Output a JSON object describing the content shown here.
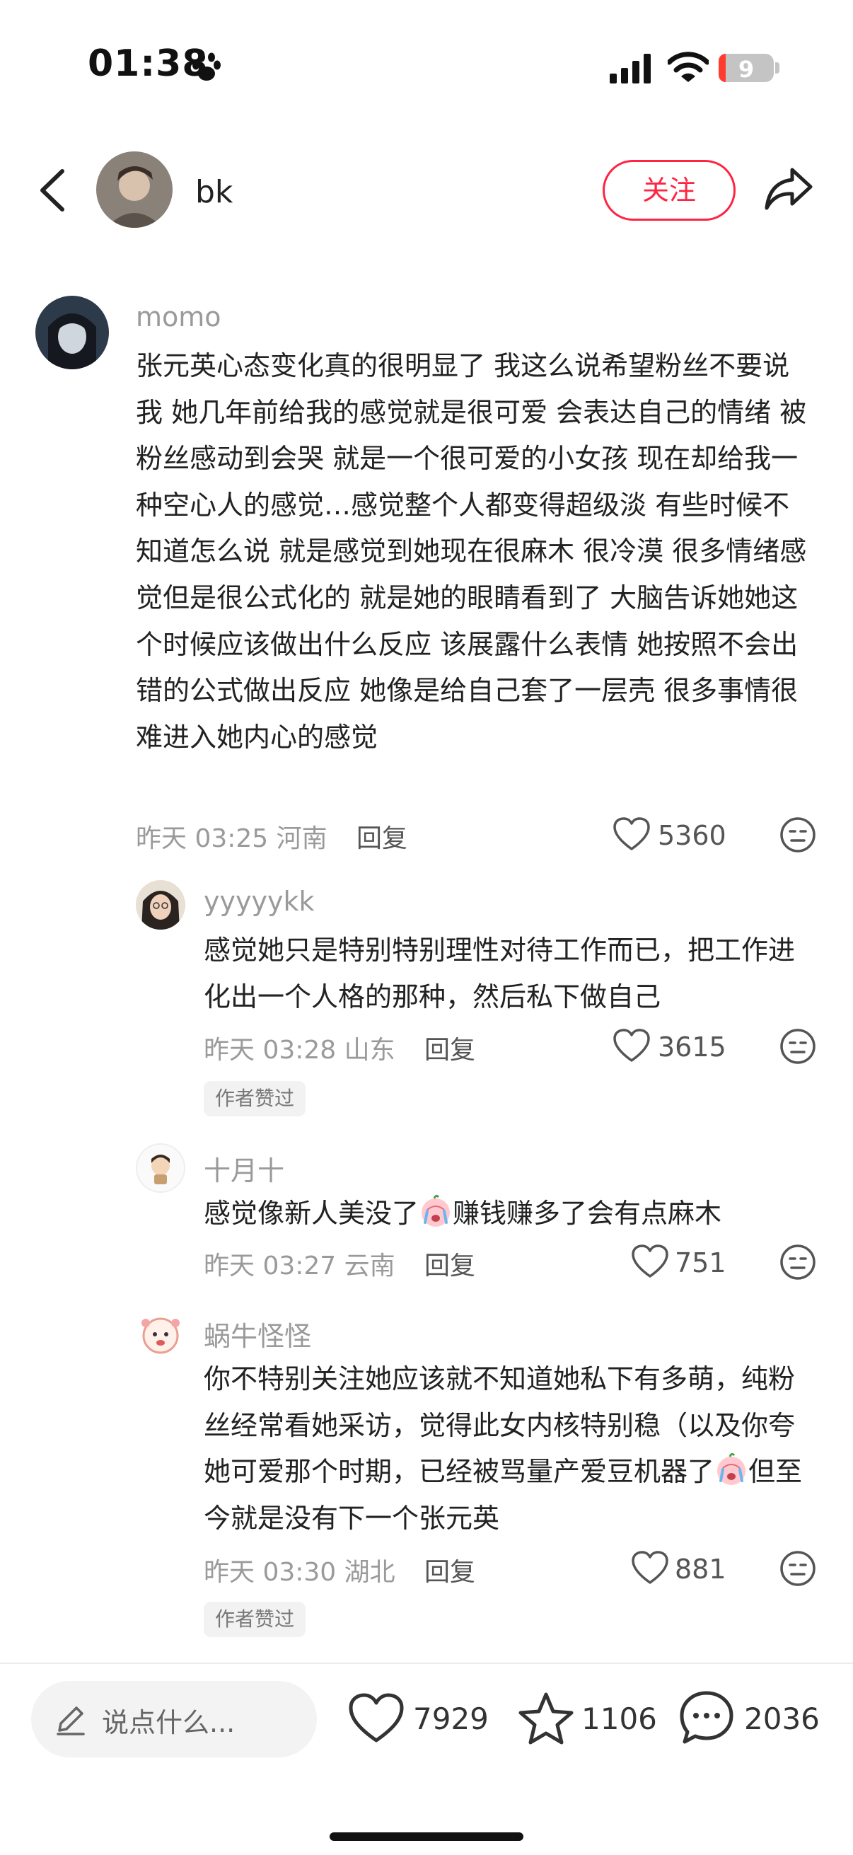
{
  "status_bar": {
    "time": "01:38",
    "battery": "9"
  },
  "header": {
    "username": "bk",
    "follow_label": "关注"
  },
  "comments": [
    {
      "author": "momo",
      "text": "张元英心态变化真的很明显了 我这么说希望粉丝不要说我 她几年前给我的感觉就是很可爱 会表达自己的情绪 被粉丝感动到会哭 就是一个很可爱的小女孩 现在却给我一种空心人的感觉…感觉整个人都变得超级淡 有些时候不知道怎么说 就是感觉到她现在很麻木 很冷漠 很多情绪感觉但是很公式化的 就是她的眼睛看到了 大脑告诉她她这个时候应该做出什么反应 该展露什么表情 她按照不会出错的公式做出反应 她像是给自己套了一层壳 很多事情很难进入她内心的感觉",
      "meta": "昨天 03:25 河南",
      "reply_label": "回复",
      "likes": "5360"
    },
    {
      "author": "yyyyykk",
      "text": "感觉她只是特别特别理性对待工作而已，把工作进化出一个人格的那种，然后私下做自己",
      "meta": "昨天 03:28 山东",
      "reply_label": "回复",
      "likes": "3615",
      "badge": "作者赞过"
    },
    {
      "author": "十月十",
      "text_before": "感觉像新人美没了",
      "text_after": "赚钱赚多了会有点麻木",
      "meta": "昨天 03:27 云南",
      "reply_label": "回复",
      "likes": "751"
    },
    {
      "author": "蜗牛怪怪",
      "text_before": "你不特别关注她应该就不知道她私下有多萌，纯粉丝经常看她采访，觉得此女内核特别稳（以及你夸她可爱那个时期，已经被骂量产爱豆机器了",
      "text_after": "但至今就是没有下一个张元英",
      "meta": "昨天 03:30 湖北",
      "reply_label": "回复",
      "likes": "881",
      "badge": "作者赞过"
    }
  ],
  "bottom_bar": {
    "placeholder": "说点什么...",
    "likes": "7929",
    "collects": "1106",
    "comments": "2036"
  },
  "colors": {
    "accent": "#ff2442",
    "muted": "#9a9a9a"
  }
}
